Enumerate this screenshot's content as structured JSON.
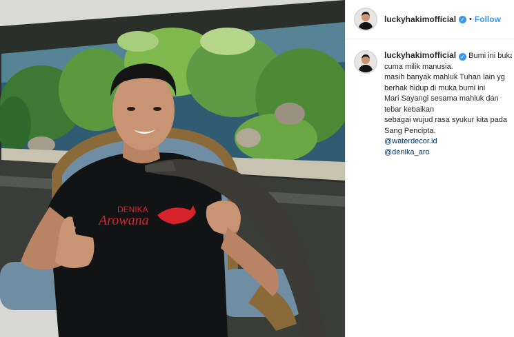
{
  "post": {
    "username": "luckyhakimofficial",
    "verified_icon": "verified-check-icon",
    "separator": "•",
    "follow_label": "Follow"
  },
  "caption": {
    "username": "luckyhakimofficial",
    "lines": [
      "Bumi ini bukan",
      "cuma milik manusia.",
      "masih banyak mahluk Tuhan lain yg",
      "berhak hidup di muka bumi ini",
      "Mari Sayangi sesama mahluk dan",
      "tebar kebaikan",
      "sebagai wujud rasa syukur kita pada",
      "Sang Pencipta."
    ],
    "mentions": [
      "@waterdecor.id",
      "@denika_aro"
    ]
  },
  "photo": {
    "shirt_logo_text_top": "DENIKA",
    "shirt_logo_text_main": "Arowana",
    "colors": {
      "accent": "#3897f0",
      "mention": "#003569",
      "shirt": "#121314",
      "logo": "#d8232a"
    }
  }
}
